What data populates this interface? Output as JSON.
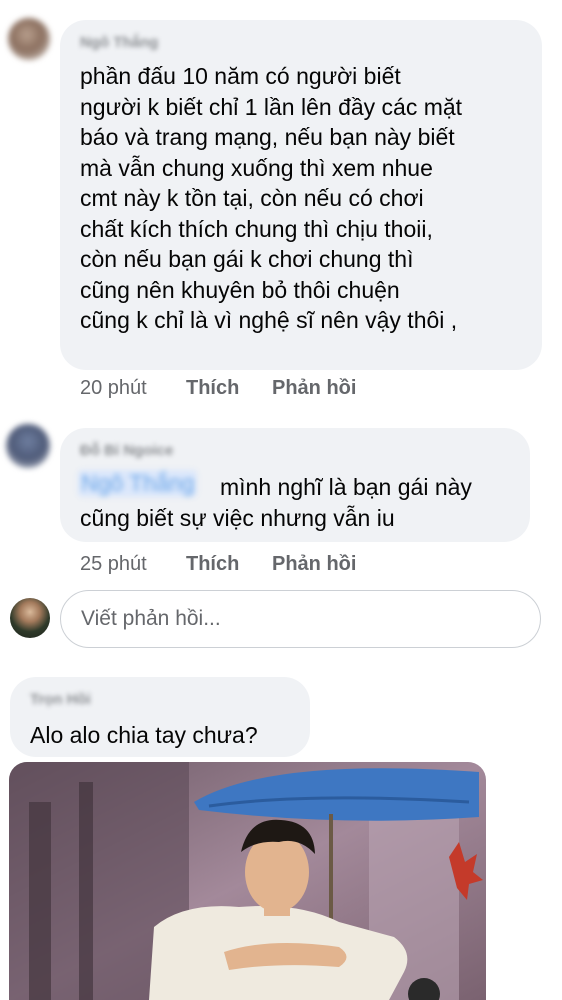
{
  "comments": [
    {
      "author": "Ngô Thắng",
      "lines": [
        "phần đấu 10 năm có người biết",
        "người k biết chỉ 1 lần lên đầy các mặt",
        "báo và trang mạng, nếu bạn này biết",
        "mà vẫn chung xuống thì xem nhue",
        "cmt này k tồn tại, còn nếu có chơi",
        "chất kích thích chung thì chịu thoii,",
        "còn nếu bạn gái k chơi chung thì",
        "cũng nên khuyên bỏ thôi chuện",
        "cũng k chỉ là vì nghệ sĩ nên vậy thôi ,"
      ],
      "time": "20 phút",
      "like": "Thích",
      "reply": "Phản hồi"
    },
    {
      "author": "Đỗ Bỉ Ngoice",
      "mention": "Ngô Thắng",
      "lines": [
        "mình nghĩ là bạn gái này",
        "cũng biết sự việc nhưng vẫn iu"
      ],
      "time": "25 phút",
      "like": "Thích",
      "reply": "Phản hồi"
    },
    {
      "author": "Trọn Hồi",
      "lines": [
        "Alo alo chia tay chưa?"
      ]
    }
  ],
  "reply_input": {
    "placeholder": "Viết phản hồi..."
  },
  "icons": [
    "avatar-icon"
  ],
  "colors": {
    "bubble": "#f0f2f5",
    "meta": "#65676b",
    "mention": "#6aa6e8"
  }
}
